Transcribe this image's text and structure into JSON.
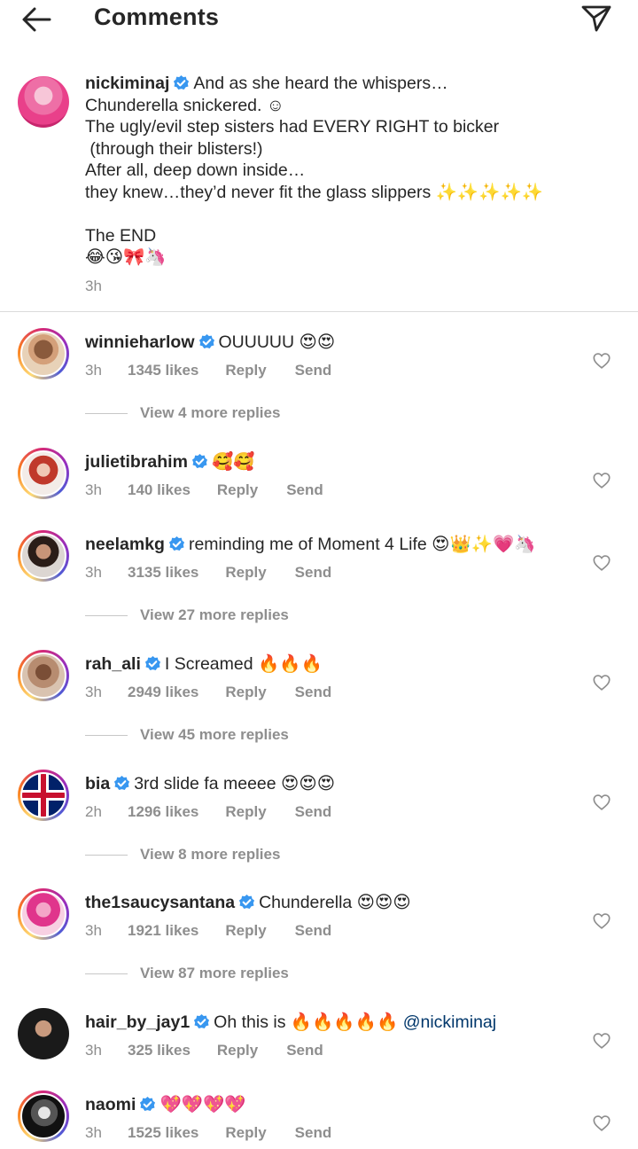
{
  "header": {
    "title": "Comments",
    "back_icon": "arrow-left-icon",
    "share_icon": "paper-plane-icon"
  },
  "caption": {
    "username": "nickiminaj",
    "verified": true,
    "text": "And as she heard the whispers…\nChunderella snickered. ☺\nThe ugly/evil step sisters had EVERY RIGHT to bicker\n (through their blisters!)\nAfter all, deep down inside…\nthey knew…they’d never fit the glass slippers ✨✨✨✨✨\n\nThe END\n😂😘🎀🦄",
    "time": "3h"
  },
  "comments": [
    {
      "username": "winnieharlow",
      "text": "OUUUUU 😍😍",
      "time": "3h",
      "likes": "1345 likes",
      "reply": "Reply",
      "send": "Send",
      "view_more": "View 4 more replies"
    },
    {
      "username": "julietibrahim",
      "text": "🥰🥰",
      "time": "3h",
      "likes": "140 likes",
      "reply": "Reply",
      "send": "Send",
      "view_more": ""
    },
    {
      "username": "neelamkg",
      "text": "reminding me of Moment 4 Life 😍👑✨💗🦄",
      "time": "3h",
      "likes": "3135 likes",
      "reply": "Reply",
      "send": "Send",
      "view_more": "View 27 more replies"
    },
    {
      "username": "rah_ali",
      "text": "I Screamed 🔥🔥🔥",
      "time": "3h",
      "likes": "2949 likes",
      "reply": "Reply",
      "send": "Send",
      "view_more": "View 45 more replies"
    },
    {
      "username": "bia",
      "text": "3rd slide fa meeee 😍😍😍",
      "time": "2h",
      "likes": "1296 likes",
      "reply": "Reply",
      "send": "Send",
      "view_more": "View 8 more replies"
    },
    {
      "username": "the1saucysantana",
      "text": "Chunderella 😍😍😍",
      "time": "3h",
      "likes": "1921 likes",
      "reply": "Reply",
      "send": "Send",
      "view_more": "View 87 more replies"
    },
    {
      "username": "hair_by_jay1",
      "text": "Oh this is 🔥🔥🔥🔥🔥",
      "mention": "@nickiminaj",
      "time": "3h",
      "likes": "325 likes",
      "reply": "Reply",
      "send": "Send",
      "view_more": ""
    },
    {
      "username": "naomi",
      "text": "💖💖💖💖",
      "time": "3h",
      "likes": "1525 likes",
      "reply": "Reply",
      "send": "Send",
      "view_more": ""
    }
  ],
  "colors": {
    "text": "#262626",
    "secondary": "#8e8e8e",
    "verified": "#3897f0",
    "link": "#00376b"
  }
}
